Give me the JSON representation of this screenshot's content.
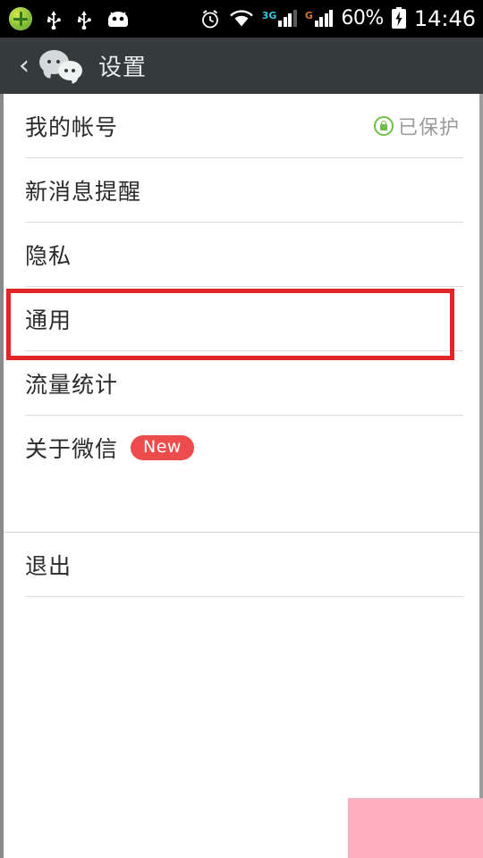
{
  "status_bar": {
    "icons_left": [
      "app-plus-icon",
      "usb-icon",
      "usb-icon",
      "android-robot-icon"
    ],
    "alarm_icon": "alarm-clock-icon",
    "wifi_icon": "wifi-icon",
    "network_1_label": "3G",
    "network_1_color": "#36c6e0",
    "network_1_bars": 3,
    "network_2_label": "G",
    "network_2_color": "#d4752e",
    "network_2_bars": 4,
    "battery_percent": "60%",
    "battery_icon": "battery-charging-icon",
    "clock": "14:46"
  },
  "title_bar": {
    "back_icon": "back-chevron-icon",
    "app_logo": "wechat-logo-icon",
    "title": "设置",
    "background_color": "#353b3d"
  },
  "settings": {
    "groups": [
      {
        "items": [
          {
            "label": "我的帐号",
            "status": "已保护",
            "status_icon": "green-lock-icon",
            "badge": null
          },
          {
            "label": "新消息提醒",
            "status": null,
            "status_icon": null,
            "badge": null
          },
          {
            "label": "隐私",
            "status": null,
            "status_icon": null,
            "badge": null
          },
          {
            "label": "通用",
            "status": null,
            "status_icon": null,
            "badge": null
          },
          {
            "label": "流量统计",
            "status": null,
            "status_icon": null,
            "badge": null
          },
          {
            "label": "关于微信",
            "status": null,
            "status_icon": null,
            "badge": "New"
          }
        ]
      },
      {
        "items": [
          {
            "label": "退出",
            "status": null,
            "status_icon": null,
            "badge": null
          }
        ]
      }
    ]
  },
  "annotation": {
    "highlight_target": "通用",
    "highlight_color": "#e02626"
  },
  "overlay": {
    "pink_block_color": "#fdafc0"
  }
}
